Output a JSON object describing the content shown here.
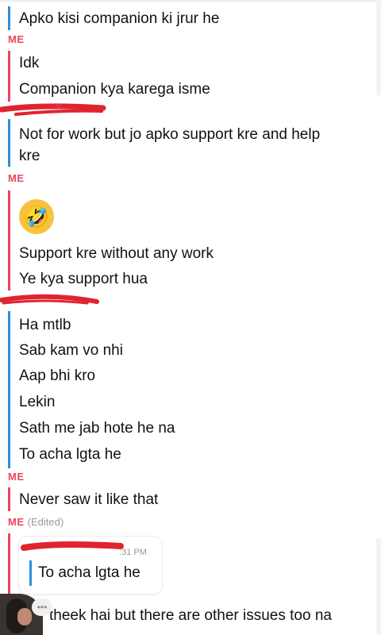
{
  "messages": {
    "b1_l1": "Apko kisi companion ki jrur he",
    "me1_label": "ME",
    "me1_l1": "Idk",
    "me1_l2": "Companion kya karega isme",
    "b2_l1": "Not for work but jo apko support kre and help",
    "b2_l2": "kre",
    "me2_label": "ME",
    "me2_emoji": "🤣",
    "me2_l1": "Support kre without any work",
    "me2_l2": "Ye kya support hua",
    "b3_l1": "Ha mtlb",
    "b3_l2": "Sab kam vo nhi",
    "b3_l3": "Aap bhi kro",
    "b3_l4": "Lekin",
    "b3_l5": "Sath me jab hote he na",
    "b3_l6": "To acha lgta he",
    "me3_label": "ME",
    "me3_l1": "Never saw it like that",
    "me4_label": "ME",
    "me4_edited": "(Edited)",
    "quote_time": ":31 PM",
    "quote_text": "To acha lgta he",
    "me4_l1": "theek hai but there are other issues too na",
    "typing_dots": "•••"
  },
  "colors": {
    "me_accent": "#e8455f",
    "friend_accent": "#2f8fd8",
    "redaction": "#e0242f"
  }
}
